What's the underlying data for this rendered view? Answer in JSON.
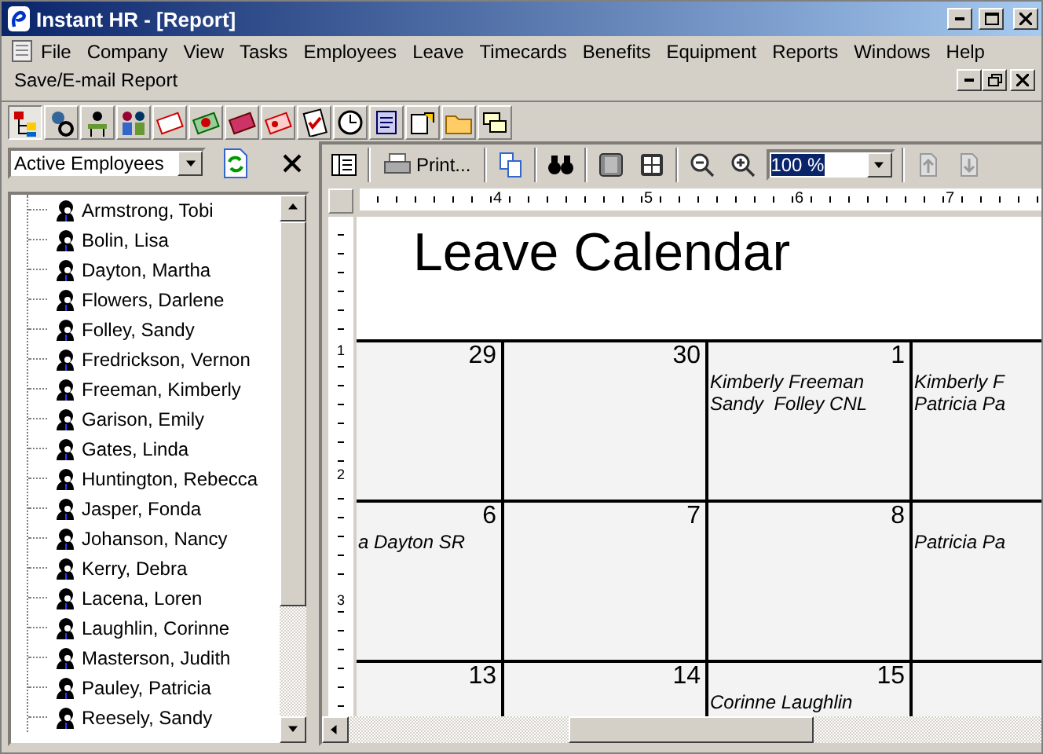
{
  "window": {
    "title": "Instant HR - [Report]"
  },
  "menu": [
    "File",
    "Company",
    "View",
    "Tasks",
    "Employees",
    "Leave",
    "Timecards",
    "Benefits",
    "Equipment",
    "Reports",
    "Windows",
    "Help"
  ],
  "report_menu": {
    "label": "Save/E-mail Report"
  },
  "filter": {
    "value": "Active Employees"
  },
  "employees": [
    "Armstrong, Tobi",
    "Bolin, Lisa",
    "Dayton, Martha",
    "Flowers, Darlene",
    "Folley, Sandy",
    "Fredrickson, Vernon",
    "Freeman, Kimberly",
    "Garison, Emily",
    "Gates, Linda",
    "Huntington, Rebecca",
    "Jasper, Fonda",
    "Johanson, Nancy",
    "Kerry, Debra",
    "Lacena, Loren",
    "Laughlin, Corinne",
    "Masterson, Judith",
    "Pauley, Patricia",
    "Reesely, Sandy"
  ],
  "preview_toolbar": {
    "print": "Print...",
    "zoom": "100 %"
  },
  "ruler": {
    "horizontal": [
      "4",
      "5",
      "6",
      "7"
    ],
    "vertical": [
      "1",
      "2",
      "3"
    ]
  },
  "report": {
    "title": "Leave Calendar",
    "weeks": [
      [
        {
          "day": "29"
        },
        {
          "day": "30"
        },
        {
          "day": "1",
          "entries": [
            "Kimberly Freeman",
            "Sandy  Folley CNL"
          ]
        },
        {
          "entries": [
            "Kimberly F",
            "Patricia Pa"
          ]
        }
      ],
      [
        {
          "day": "6",
          "entries": [
            "a Dayton SR"
          ]
        },
        {
          "day": "7"
        },
        {
          "day": "8"
        },
        {
          "entries": [
            "Patricia Pa"
          ]
        }
      ],
      [
        {
          "day": "13"
        },
        {
          "day": "14"
        },
        {
          "day": "15",
          "entries": [
            "Corinne Laughlin"
          ]
        }
      ]
    ]
  }
}
